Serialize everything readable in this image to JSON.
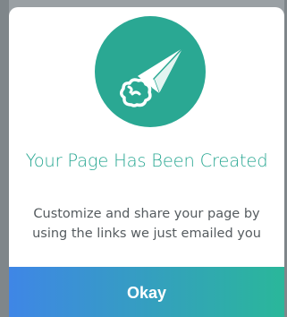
{
  "modal": {
    "icon": "paper-plane-icon",
    "title": "Your Page Has Been Created",
    "description": "Customize and share your page by using the links we just emailed you",
    "okay_label": "Okay"
  },
  "colors": {
    "accent": "#2aa893",
    "button_gradient_start": "#3f86e6",
    "button_gradient_end": "#2ab79a",
    "text": "#555b5f"
  }
}
